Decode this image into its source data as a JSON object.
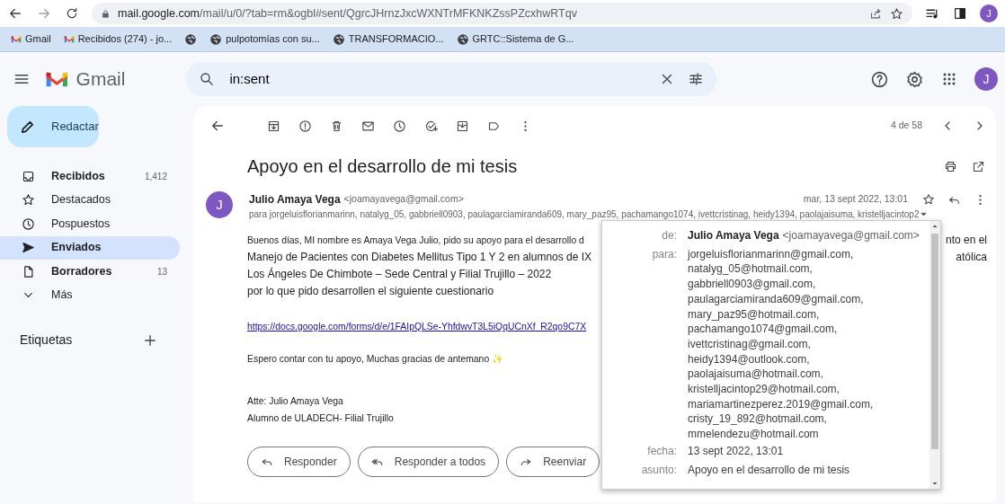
{
  "browser": {
    "url_host": "mail.google.com",
    "url_path": "/mail/u/0/?tab=rm&ogbl#sent/QgrcJHrnzJxcWXNTrMFKNKZssPZcxhwRTqv",
    "profile_initial": "J",
    "bookmarks": [
      {
        "kind": "gmail",
        "label": "Gmail"
      },
      {
        "kind": "gmail",
        "label": "Recibidos (274) - jo..."
      },
      {
        "kind": "globe"
      },
      {
        "kind": "globe",
        "label": "pulpotomías con su..."
      },
      {
        "kind": "globe",
        "label": "TRANSFORMACIO..."
      },
      {
        "kind": "globe",
        "label": "GRTC::Sistema de G..."
      }
    ]
  },
  "app": {
    "name": "Gmail",
    "search": {
      "value": "in:sent"
    },
    "avatar_initial": "J"
  },
  "compose": {
    "label": "Redactar"
  },
  "folders": [
    {
      "label": "Recibidos",
      "count": "1,412",
      "unread": true,
      "selected": false
    },
    {
      "label": "Destacados",
      "unread": false,
      "selected": false
    },
    {
      "label": "Pospuestos",
      "unread": false,
      "selected": false
    },
    {
      "label": "Enviados",
      "unread": true,
      "selected": true
    },
    {
      "label": "Borradores",
      "count": "13",
      "unread": true,
      "selected": false
    },
    {
      "label": "Más",
      "unread": false,
      "selected": false
    }
  ],
  "labels_heading": "Etiquetas",
  "toolbar": {
    "pager": "4 de 58"
  },
  "message": {
    "subject": "Apoyo en el desarrollo de mi tesis",
    "sender": {
      "initial": "J",
      "name": "Julio Amaya Vega",
      "email": "<joamayavega@gmail.com>"
    },
    "recipients_line": "para jorgeluisflorianmarinn, natalyg_05, gabbriell0903, paulagarciamiranda609, mary_paz95, pachamango1074, ivettcristinag, heidy1394, paolajaisuma, kristelljacintop2",
    "date": "mar, 13 sept 2022, 13:01",
    "body": [
      {
        "kind": "para",
        "lines": [
          {
            "kind": "small",
            "text": "Buenos días, MI nombre es Amaya Vega Julio, pido su apoyo para el desarrollo d",
            "right": "nto en el"
          },
          {
            "kind": "large",
            "text": "Manejo de Pacientes con Diabetes Mellitus Tipo 1 Y 2 en alumnos de IX",
            "right": "atólica"
          },
          {
            "kind": "large",
            "text": "Los Ángeles De Chimbote – Sede Central y Filial Trujillo – 2022"
          },
          {
            "kind": "large",
            "text": "por lo que pido desarrollen el siguiente cuestionario"
          }
        ]
      },
      {
        "kind": "link",
        "text": "https://docs.google.com/forms/d/e/1FAIpQLSe-YhfdwvT3L5iQqUCnXf_R2qo9C7X"
      },
      {
        "kind": "para",
        "lines": [
          {
            "kind": "small",
            "text": "Espero contar con tu apoyo, Muchas gracias de antemano ✨"
          }
        ]
      },
      {
        "kind": "signature",
        "lines": [
          {
            "kind": "small",
            "text": "Atte: Julio Amaya Vega"
          },
          {
            "kind": "small",
            "text": "Alumno de ULADECH- Filial Trujillo"
          }
        ]
      }
    ],
    "actions": [
      {
        "label": "Responder"
      },
      {
        "label": "Responder a todos"
      },
      {
        "label": "Reenviar"
      }
    ]
  },
  "details_popup": {
    "rows": [
      {
        "kind": "sender",
        "label": "de:",
        "name": "Julio Amaya Vega",
        "email": "<joamayavega@gmail.com>"
      },
      {
        "kind": "list",
        "label": "para:",
        "values": [
          "jorgeluisflorianmarinn@gmail.com,",
          "natalyg_05@hotmail.com,",
          "gabbriell0903@gmail.com,",
          "paulagarciamiranda609@gmail.com,",
          "mary_paz95@hotmail.com,",
          "pachamango1074@gmail.com,",
          "ivettcristinag@gmail.com,",
          "heidy1394@outlook.com,",
          "paolajaisuma@hotmail.com,",
          "kristelljacintop29@hotmail.com,",
          "mariamartinezperez.2019@gmail.com,",
          "cristy_19_892@hotmail.com,",
          "mmelendezu@hotmail.com"
        ]
      },
      {
        "kind": "text",
        "label": "fecha:",
        "value": "13 sept 2022, 13:01"
      },
      {
        "kind": "text",
        "label": "asunto:",
        "value": "Apoyo en el desarrollo de mi tesis"
      }
    ]
  }
}
